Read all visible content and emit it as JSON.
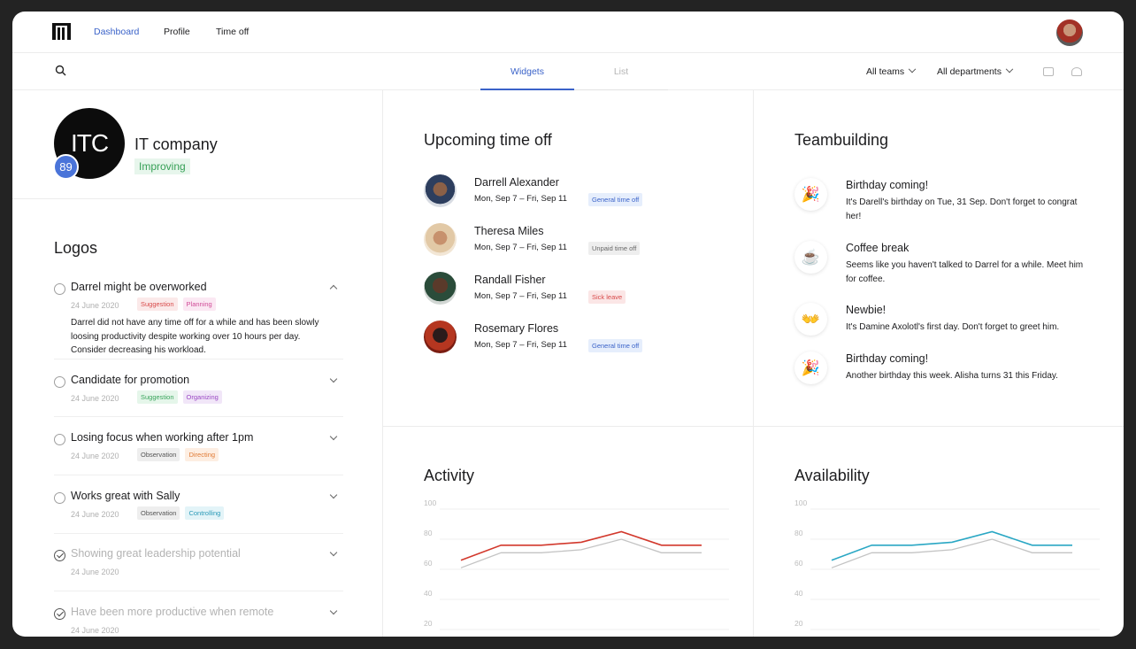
{
  "nav": {
    "links": [
      "Dashboard",
      "Profile",
      "Time off"
    ]
  },
  "subbar": {
    "tabs": [
      "Widgets",
      "List"
    ],
    "filters": [
      "All teams",
      "All departments"
    ]
  },
  "company": {
    "initials": "ITC",
    "score": "89",
    "name": "IT company",
    "status": "Improving"
  },
  "logos": {
    "title": "Logos",
    "items": [
      {
        "title": "Darrel might be overworked",
        "date": "24 June 2020",
        "tags": [
          "Suggestion",
          "Planning"
        ],
        "description": "Darrel did not have any time off for a while and has been slowly loosing productivity despite working over 10 hours per day. Consider decreasing his workload.",
        "expanded": true,
        "done": false
      },
      {
        "title": "Candidate for promotion",
        "date": "24 June 2020",
        "tags": [
          "Suggestion",
          "Organizing"
        ],
        "done": false
      },
      {
        "title": "Losing focus when working after 1pm",
        "date": "24 June 2020",
        "tags": [
          "Observation",
          "Directing"
        ],
        "done": false
      },
      {
        "title": "Works great with Sally",
        "date": "24 June 2020",
        "tags": [
          "Observation",
          "Controlling"
        ],
        "done": false
      },
      {
        "title": "Showing great leadership potential",
        "date": "24 June 2020",
        "tags": [],
        "done": true
      },
      {
        "title": "Have been more productive when remote",
        "date": "24 June 2020",
        "tags": [],
        "done": true
      }
    ]
  },
  "time_off": {
    "title": "Upcoming time off",
    "people": [
      {
        "name": "Darrell Alexander",
        "dates": "Mon, Sep 7 – Fri, Sep 11",
        "type": "General time off"
      },
      {
        "name": "Theresa Miles",
        "dates": "Mon, Sep 7 – Fri, Sep 11",
        "type": "Unpaid time off"
      },
      {
        "name": "Randall Fisher",
        "dates": "Mon, Sep 7 – Fri, Sep 11",
        "type": "Sick leave"
      },
      {
        "name": "Rosemary Flores",
        "dates": "Mon, Sep 7 – Fri, Sep 11",
        "type": "General time off"
      }
    ]
  },
  "teambuilding": {
    "title": "Teambuilding",
    "events": [
      {
        "icon": "party-popper-icon",
        "glyph": "🎉",
        "title": "Birthday coming!",
        "description": "It's Darell's birthday on Tue, 31 Sep. Don't forget to congrat her!"
      },
      {
        "icon": "coffee-icon",
        "glyph": "☕",
        "title": "Coffee break",
        "description": "Seems like you haven't talked to Darrel for a while. Meet him for coffee."
      },
      {
        "icon": "waving-hands-icon",
        "glyph": "👐",
        "title": "Newbie!",
        "description": "It's Damine Axolotl's first day. Don't forget to greet him."
      },
      {
        "icon": "party-popper-icon",
        "glyph": "🎉",
        "title": "Birthday coming!",
        "description": "Another birthday this week. Alisha turns 31 this Friday."
      }
    ]
  },
  "colors": {
    "accent": "#3b63c9",
    "activity_line": "#d2382c",
    "availability_line": "#2aa7c4",
    "baseline_line": "#c4c4c4"
  },
  "chart_data": [
    {
      "type": "line",
      "title": "Activity",
      "y_ticks": [
        "100",
        "80",
        "60",
        "40",
        "20"
      ],
      "ylim": [
        20,
        100
      ],
      "series": [
        {
          "values": [
            66,
            76,
            76,
            78,
            85,
            76,
            76
          ]
        },
        {
          "values": [
            61,
            71,
            71,
            73,
            80,
            71,
            71
          ]
        }
      ]
    },
    {
      "type": "line",
      "title": "Availability",
      "y_ticks": [
        "100",
        "80",
        "60",
        "40",
        "20"
      ],
      "ylim": [
        20,
        100
      ],
      "series": [
        {
          "values": [
            66,
            76,
            76,
            78,
            85,
            76,
            76
          ]
        },
        {
          "values": [
            61,
            71,
            71,
            73,
            80,
            71,
            71
          ]
        }
      ]
    }
  ]
}
